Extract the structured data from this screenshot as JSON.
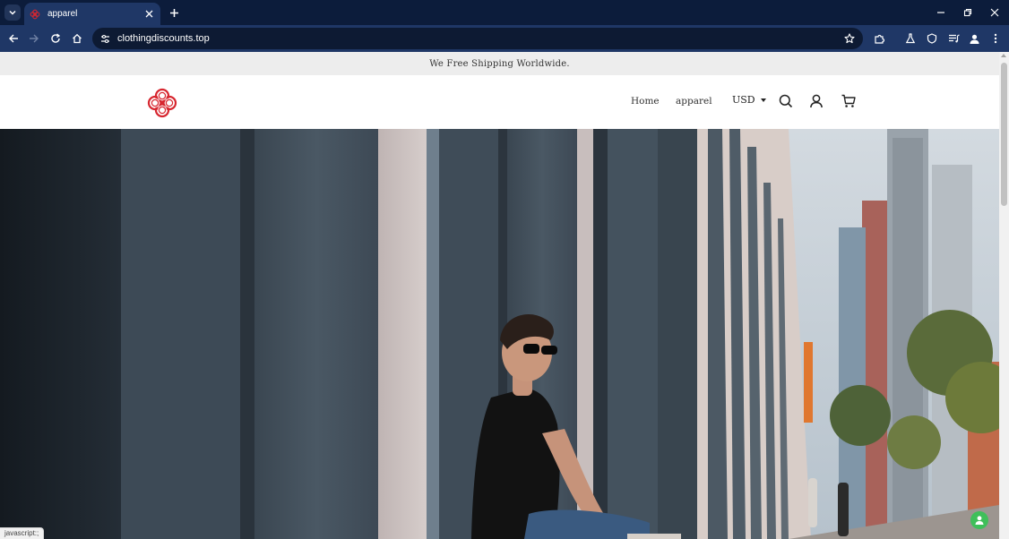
{
  "browser": {
    "tab": {
      "title": "apparel",
      "favicon": "brand-knot-icon"
    },
    "address": {
      "url": "clothingdiscounts.top"
    },
    "icons": [
      "tab-search-icon",
      "close-icon",
      "plus-icon",
      "minimize-icon",
      "restore-icon",
      "back-icon",
      "forward-icon",
      "reload-icon",
      "home-icon",
      "site-info-icon",
      "bookmark-star-icon",
      "extensions-icon",
      "labs-icon",
      "shield-icon",
      "media-icon",
      "profile-icon",
      "menu-dots-icon"
    ],
    "status_text": "javascript:;"
  },
  "site": {
    "announcement": "We Free Shipping Worldwide.",
    "nav": [
      {
        "label": "Home"
      },
      {
        "label": "apparel"
      }
    ],
    "currency": {
      "selected": "USD"
    },
    "icons": [
      "search-icon",
      "account-icon",
      "cart-icon"
    ],
    "brand_color": "#d7262f"
  },
  "hero": {
    "image": "street-photo-man-sitting-sunglasses-black-tshirt"
  }
}
